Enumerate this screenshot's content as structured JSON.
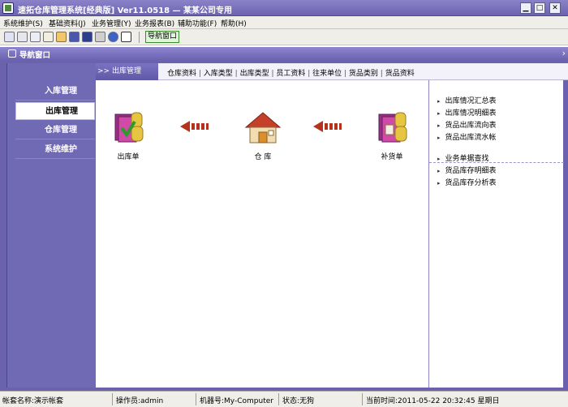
{
  "window": {
    "title": "速拓仓库管理系统[经典版] Ver11.0518 — 某某公司专用",
    "minimize_glyph": "▁",
    "maximize_glyph": "□",
    "close_glyph": "✕"
  },
  "menu": {
    "items": [
      "系统维护(S)",
      "基础资料(J)",
      "业务管理(Y)",
      "业务报表(B)",
      "辅助功能(F)",
      "帮助(H)"
    ]
  },
  "toolbar": {
    "icons": [
      "grid-icon",
      "list-icon",
      "copy-icon",
      "document-icon",
      "users-icon",
      "disk-icon",
      "save-icon",
      "printer-icon",
      "help-icon",
      "exit-icon"
    ],
    "nav_button_label": "导航窗口"
  },
  "nav_window": {
    "title": "导航窗口",
    "chevron": "›"
  },
  "sidebar": {
    "items": [
      {
        "label": "入库管理",
        "active": false
      },
      {
        "label": "出库管理",
        "active": true
      },
      {
        "label": "仓库管理",
        "active": false
      },
      {
        "label": "系统维护",
        "active": false
      }
    ]
  },
  "breadcrumb": {
    "current": ">> 出库管理",
    "links": [
      "仓库资料",
      "入库类型",
      "出库类型",
      "员工资料",
      "往来单位",
      "货品类别",
      "货品资料"
    ]
  },
  "flow": {
    "nodes": [
      {
        "label": "出库单",
        "icon": "outbound-document-icon"
      },
      {
        "label": "仓 库",
        "icon": "warehouse-icon"
      },
      {
        "label": "补货单",
        "icon": "replenish-document-icon"
      }
    ],
    "arrow_color": "#b5321c"
  },
  "reports": {
    "group1": [
      "出库情况汇总表",
      "出库情况明细表",
      "货品出库流向表",
      "货品出库流水帐"
    ],
    "group2": [
      "业务单据查找",
      "货品库存明细表",
      "货品库存分析表"
    ]
  },
  "status": {
    "account": "帐套名称:演示帐套",
    "operator": "操作员:admin",
    "machine": "机器号:My-Computer",
    "state": "状态:无狗",
    "time": "当前时间:2011-05-22 20:32:45 星期日"
  },
  "colors": {
    "title_bar": "#7a71bf",
    "sidebar": "#6a62ad",
    "active_item_bg": "#ffffff",
    "button_green": "#3d8a2d"
  }
}
